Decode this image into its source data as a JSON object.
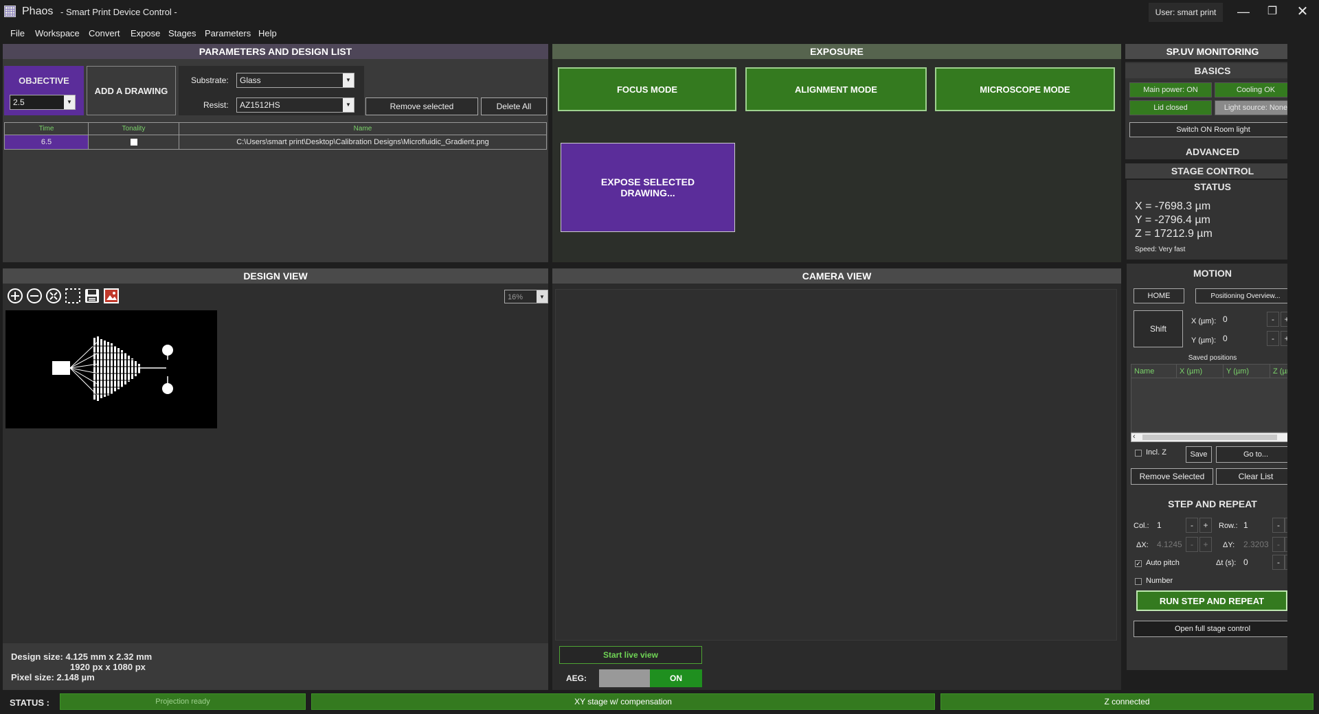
{
  "app": {
    "name": "Phaos",
    "title": "- Smart Print Device Control -",
    "user": "User: smart print"
  },
  "menu": [
    "File",
    "Workspace",
    "Convert",
    "Expose",
    "Stages",
    "Parameters",
    "Help"
  ],
  "params": {
    "header": "PARAMETERS AND DESIGN LIST",
    "objective_label": "OBJECTIVE",
    "objective_value": "2.5",
    "add_drawing": "ADD A DRAWING",
    "substrate_label": "Substrate:",
    "substrate_value": "Glass",
    "resist_label": "Resist:",
    "resist_value": "AZ1512HS",
    "remove_selected": "Remove selected",
    "delete_all": "Delete All",
    "columns": [
      "Time",
      "Tonality",
      "Name"
    ],
    "rows": [
      {
        "time": "6.5",
        "name": "C:\\Users\\smart print\\Desktop\\Calibration Designs\\Microfluidic_Gradient.png"
      }
    ]
  },
  "exposure": {
    "header": "EXPOSURE",
    "focus": "FOCUS MODE",
    "alignment": "ALIGNMENT MODE",
    "microscope": "MICROSCOPE MODE",
    "expose": "EXPOSE SELECTED DRAWING..."
  },
  "design_view": {
    "header": "DESIGN VIEW",
    "zoom": "16%",
    "size_line1": "Design size: 4.125 mm x 2.32 mm",
    "size_line2": "1920 px x 1080 px",
    "pixel_size": "Pixel size: 2.148 µm"
  },
  "camera_view": {
    "header": "CAMERA VIEW",
    "start_live": "Start live view",
    "aeg_label": "AEG:",
    "aeg_on": "ON"
  },
  "monitoring": {
    "header": "SP.UV MONITORING",
    "basics": "BASICS",
    "main_power": "Main power: ON",
    "cooling": "Cooling OK",
    "lid": "Lid closed",
    "light_source": "Light source: None",
    "room_light": "Switch ON Room light",
    "advanced": "ADVANCED"
  },
  "stage": {
    "header": "STAGE CONTROL",
    "status": "STATUS",
    "x": "X = -7698.3 µm",
    "y": "Y = -2796.4 µm",
    "z": "Z = 17212.9 µm",
    "speed": "Speed: Very fast",
    "motion": "MOTION",
    "home": "HOME",
    "positioning": "Positioning Overview...",
    "shift": "Shift",
    "x_label": "X (µm):",
    "y_label": "Y (µm):",
    "x_value": "0",
    "y_value": "0",
    "saved_positions": "Saved positions",
    "saved_columns": [
      "Name",
      "X (µm)",
      "Y (µm)",
      "Z (µm"
    ],
    "incl_z": "Incl. Z",
    "save": "Save",
    "goto": "Go to...",
    "remove_selected": "Remove Selected",
    "clear_list": "Clear List"
  },
  "step_repeat": {
    "header": "STEP AND REPEAT",
    "col_label": "Col.:",
    "col_value": "1",
    "row_label": "Row.:",
    "row_value": "1",
    "dx_label": "ΔX:",
    "dx_value": "4.1245",
    "dy_label": "ΔY:",
    "dy_value": "2.3203",
    "auto_pitch": "Auto pitch",
    "dt_label": "Δt (s):",
    "dt_value": "0",
    "number": "Number",
    "run": "RUN STEP AND REPEAT",
    "open_full": "Open full stage control"
  },
  "statusbar": {
    "label": "STATUS :",
    "projection": "Projection ready",
    "xy": "XY stage w/ compensation",
    "z": "Z connected"
  },
  "colors": {
    "green": "#347a1f",
    "purple": "#5b2d9a",
    "panel": "#333333"
  }
}
